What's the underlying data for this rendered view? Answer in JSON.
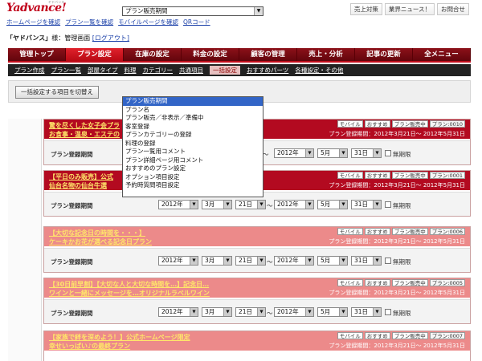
{
  "header": {
    "logo": "Yadvance!",
    "logo_sub": "ヤドバンス",
    "top_buttons": [
      "売上対策",
      "業界ニュース！",
      "お問合せ"
    ],
    "links": [
      "ホームページを確認",
      "プラン一覧を確認",
      "モバイルページを確認",
      "QRコード"
    ],
    "user_name": "「ヤドバンス」",
    "user_suffix": "様：管理画面",
    "logout": "[ログアウト]"
  },
  "main_nav": [
    "管理トップ",
    "プラン設定",
    "在庫の設定",
    "料金の設定",
    "顧客の管理",
    "売上・分析",
    "記事の更新",
    "全メニュー"
  ],
  "main_nav_active": 1,
  "sub_nav": [
    "プラン作成",
    "プラン一覧",
    "部屋タイプ",
    "料理",
    "カテゴリー",
    "共通項目",
    "一括設定",
    "おすすめパーツ",
    "各種設定・その他"
  ],
  "sub_nav_active": 6,
  "bulk": {
    "button": "一括設定する項目を切替え",
    "selected": "プラン販売期間"
  },
  "dropdown_options": [
    "プラン販売期間",
    "プラン名",
    "プラン販売／非表示／準備中",
    "客室登録",
    "プランカテゴリーの登録",
    "料理の登録",
    "プラン一覧用コメント",
    "プラン詳細ページ用コメント",
    "おすすめのプラン設定",
    "オプション項目設定",
    "予約時質問項目設定"
  ],
  "plans": [
    {
      "style": "dark",
      "title1": "驚を尽くした女子会プラ",
      "title2": "お食事・温泉・エステの",
      "badges": [
        "モバイル",
        "おすすめ",
        "プラン販売中",
        "プラン:0010"
      ],
      "note": "プラン登録期間：2012年3月21日～ 2012年5月31日",
      "row_label": "プラン登録期間",
      "start": {
        "y": "",
        "m": "",
        "d": ""
      },
      "end": {
        "y": "2012年",
        "m": "5月",
        "d": "31日"
      },
      "show_start": false,
      "unlimited": "無期限"
    },
    {
      "style": "dark",
      "title1": "【平日のみ販売】公式",
      "title2": "仙台名物の仙台牛選",
      "badges": [
        "モバイル",
        "おすすめ",
        "プラン販売中",
        "プラン:0001"
      ],
      "note": "プラン登録期間：2012年3月21日～ 2012年5月31日",
      "row_label": "プラン登録期間",
      "start": {
        "y": "2012年",
        "m": "3月",
        "d": "21日"
      },
      "end": {
        "y": "2012年",
        "m": "5月",
        "d": "31日"
      },
      "show_start": true,
      "unlimited": "無期限"
    },
    {
      "style": "light",
      "title1": "【大切な記念日の時間を・・・】",
      "title2": "ケーキかお花が選べる記念日プラン",
      "badges": [
        "モバイル",
        "おすすめ",
        "プラン販売中",
        "プラン:0006"
      ],
      "note": "プラン登録期間：2012年3月21日～ 2012年5月31日",
      "row_label": "プラン登録期間",
      "start": {
        "y": "2012年",
        "m": "3月",
        "d": "21日"
      },
      "end": {
        "y": "2012年",
        "m": "5月",
        "d": "31日"
      },
      "show_start": true,
      "unlimited": "無期限"
    },
    {
      "style": "light",
      "title1": "【30日前早割】【大切な人と大切な時間を…】記念日…",
      "title2": "ワインと一緒にメッセージを…オリジナルラベルワイン",
      "badges": [
        "モバイル",
        "おすすめ",
        "プラン販売中",
        "プラン:0005"
      ],
      "note": "プラン登録期間：2012年3月21日～ 2012年5月31日",
      "row_label": "プラン登録期間",
      "start": {
        "y": "2012年",
        "m": "3月",
        "d": "21日"
      },
      "end": {
        "y": "2012年",
        "m": "5月",
        "d": "31日"
      },
      "show_start": true,
      "unlimited": "無期限"
    },
    {
      "style": "light",
      "title1": "【家族で絆を深めよう！】公式ホームページ限定",
      "title2": "幸せいっぱい♪の最終プラン",
      "badges": [
        "モバイル",
        "おすすめ",
        "プラン販売中",
        "プラン:0007"
      ],
      "note": "プラン登録期間：2012年3月21日～ 2012年5月31日",
      "row_label": "",
      "start": {
        "y": "",
        "m": "",
        "d": ""
      },
      "end": {
        "y": "",
        "m": "",
        "d": ""
      },
      "show_start": false,
      "unlimited": ""
    }
  ],
  "tilde": "～"
}
